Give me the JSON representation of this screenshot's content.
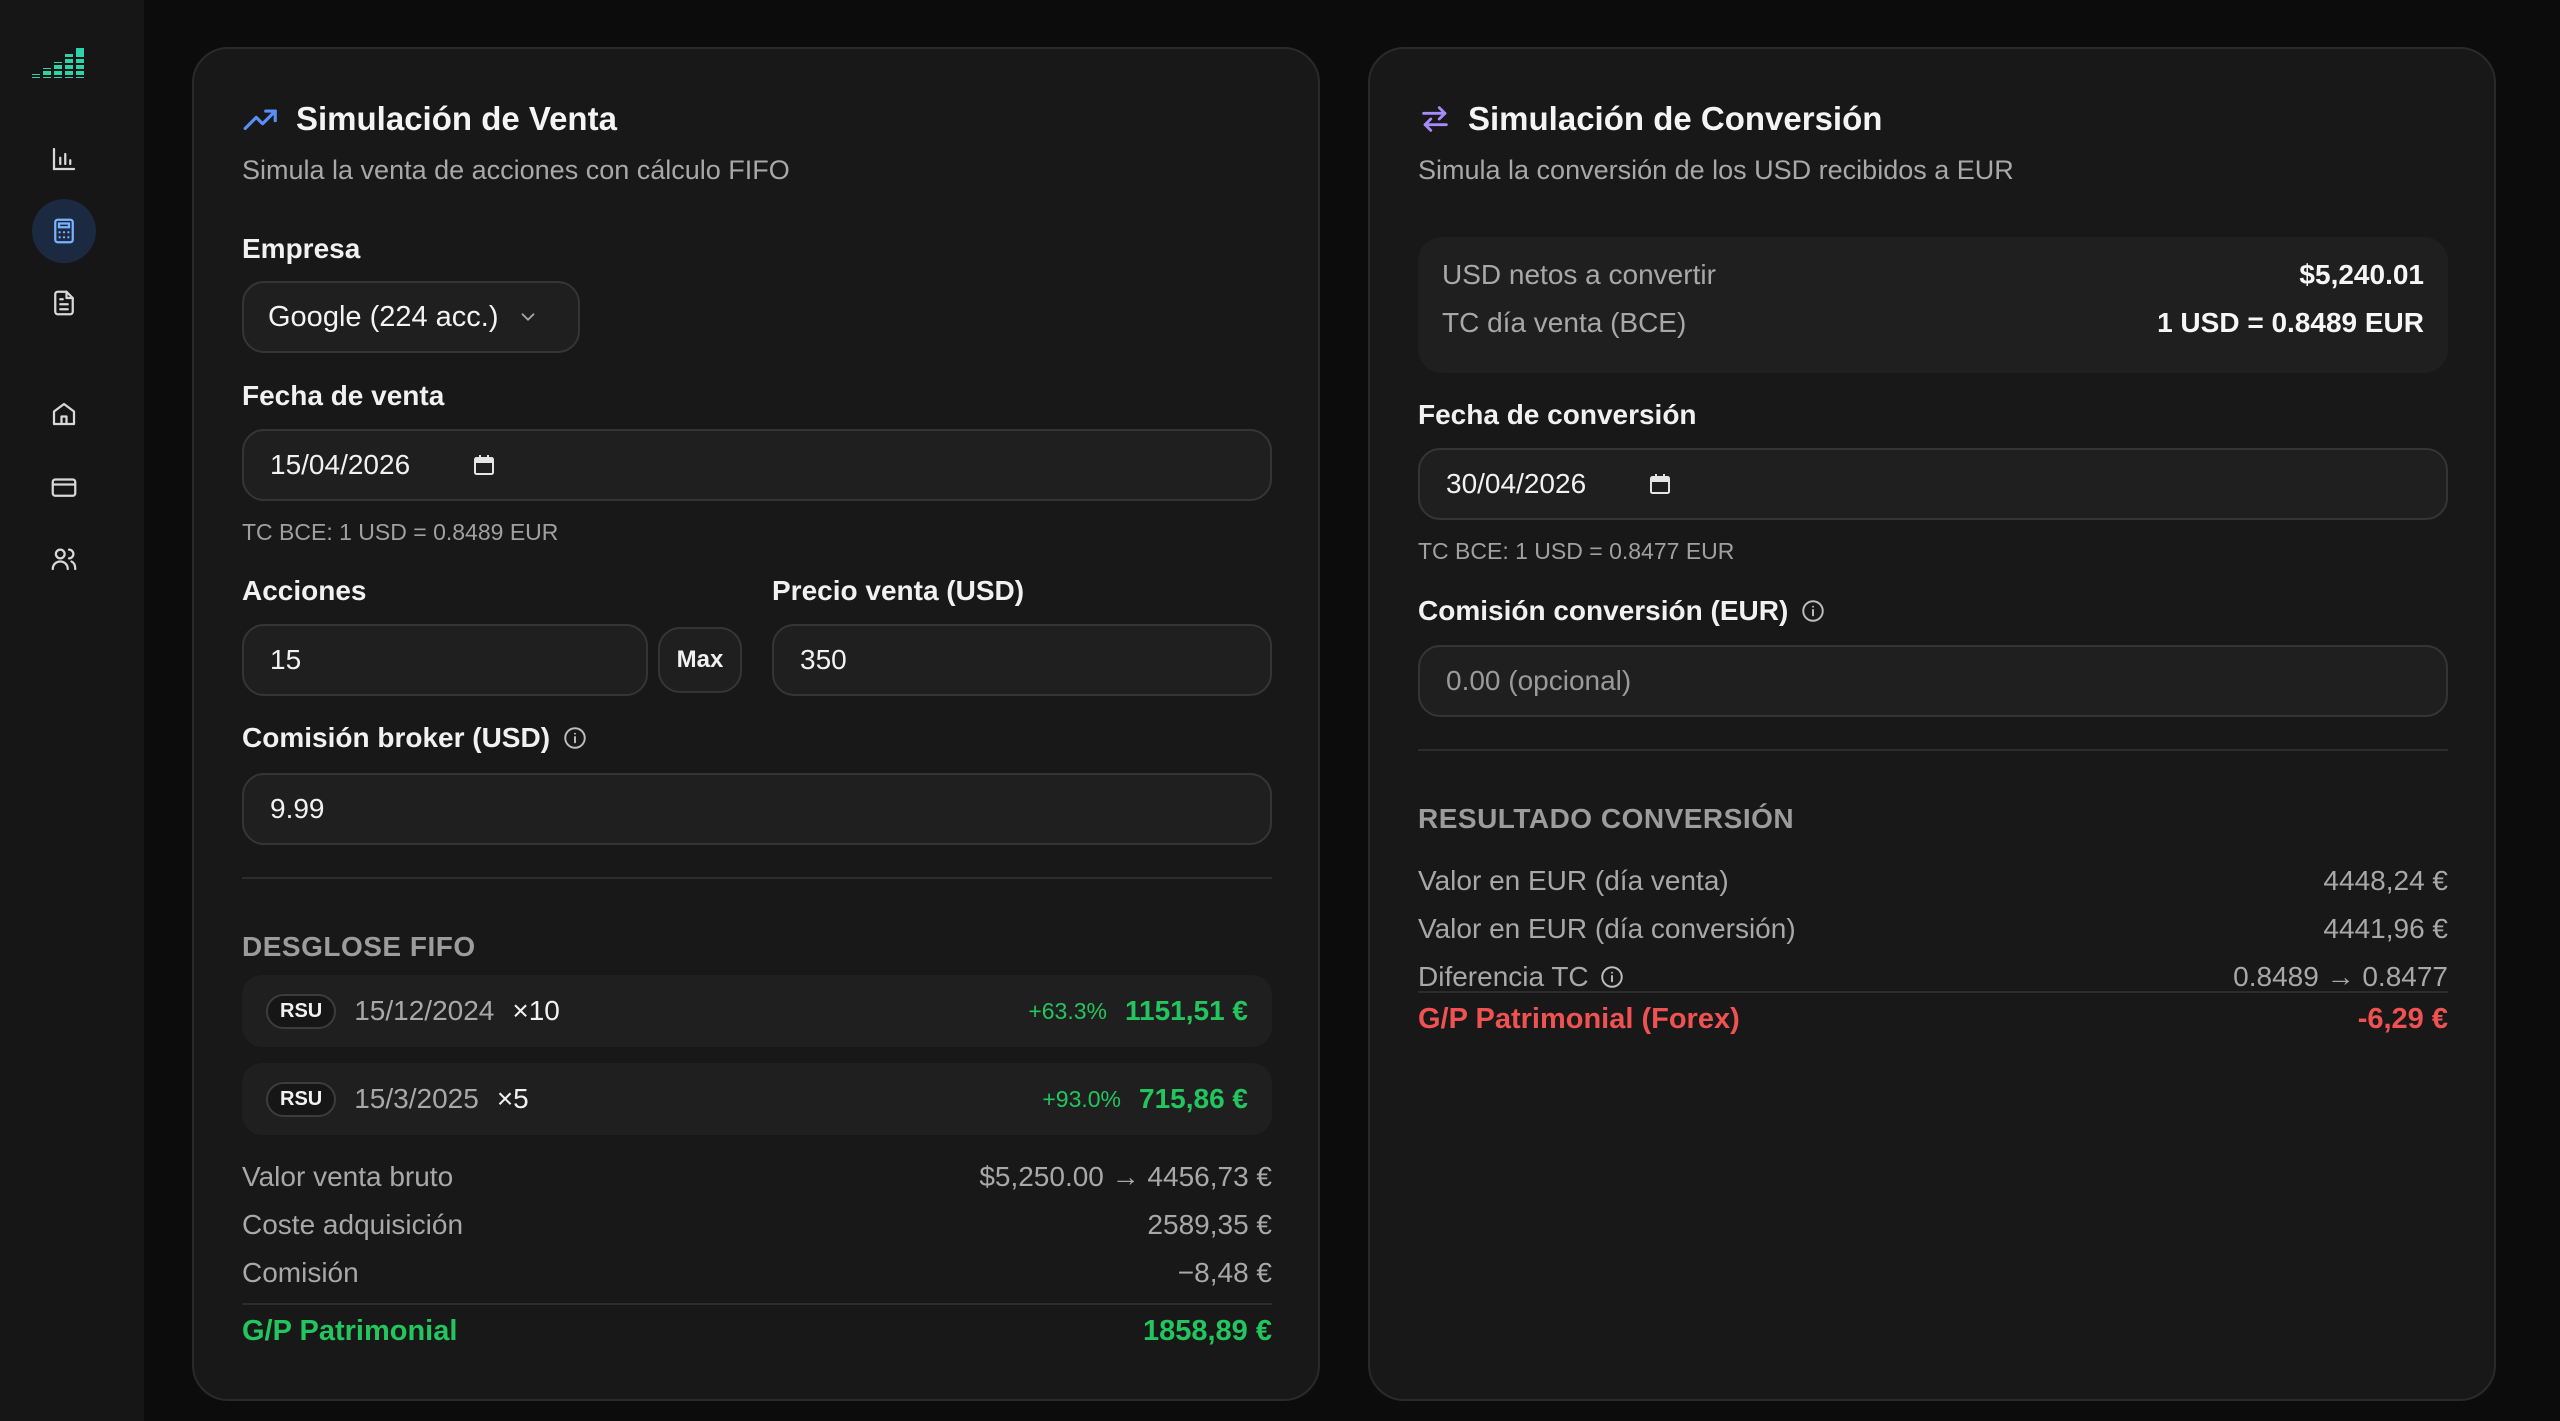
{
  "colors": {
    "accent": "#7ab2ff",
    "positive": "#22c55e",
    "negative": "#f05252",
    "logo": "#2dd4a8"
  },
  "sidebar": {
    "items": [
      {
        "icon": "bar-chart-icon"
      },
      {
        "icon": "calculator-icon",
        "active": true
      },
      {
        "icon": "document-icon"
      },
      {
        "icon": "home-icon"
      },
      {
        "icon": "credit-card-icon"
      },
      {
        "icon": "users-icon"
      }
    ]
  },
  "sale": {
    "title": "Simulación de Venta",
    "subtitle": "Simula la venta de acciones con cálculo FIFO",
    "company_label": "Empresa",
    "company_value": "Google (224 acc.)",
    "date_label": "Fecha de venta",
    "date_value": "15/04/2026",
    "date_hint": "TC BCE: 1 USD = 0.8489 EUR",
    "shares_label": "Acciones",
    "shares_value": "15",
    "max_label": "Max",
    "price_label": "Precio venta (USD)",
    "price_value": "350",
    "fee_label": "Comisión broker (USD)",
    "fee_value": "9.99",
    "fifo_header": "DESGLOSE FIFO",
    "lots": [
      {
        "type": "RSU",
        "date": "15/12/2024",
        "qty": "×10",
        "pct": "+63.3%",
        "value": "1151,51 €"
      },
      {
        "type": "RSU",
        "date": "15/3/2025",
        "qty": "×5",
        "pct": "+93.0%",
        "value": "715,86 €"
      }
    ],
    "gross_label": "Valor venta bruto",
    "gross_value": "$5,250.00 → 4456,73 €",
    "cost_label": "Coste adquisición",
    "cost_value": "2589,35 €",
    "commission_label": "Comisión",
    "commission_value": "−8,48 €",
    "gain_label": "G/P Patrimonial",
    "gain_value": "1858,89 €"
  },
  "conversion": {
    "title": "Simulación de Conversión",
    "subtitle": "Simula la conversión de los USD recibidos a EUR",
    "net_usd_label": "USD netos a convertir",
    "net_usd_value": "$5,240.01",
    "rate_label": "TC día venta (BCE)",
    "rate_value": "1 USD = 0.8489 EUR",
    "date_label": "Fecha de conversión",
    "date_value": "30/04/2026",
    "date_hint": "TC BCE: 1 USD = 0.8477 EUR",
    "fee_label": "Comisión conversión (EUR)",
    "fee_placeholder": "0.00 (opcional)",
    "result_header": "RESULTADO CONVERSIÓN",
    "eur_sale_label": "Valor en EUR (día venta)",
    "eur_sale_value": "4448,24 €",
    "eur_conv_label": "Valor en EUR (día conversión)",
    "eur_conv_value": "4441,96 €",
    "diff_label": "Diferencia TC",
    "diff_value": "0.8489 → 0.8477",
    "gain_label": "G/P Patrimonial (Forex)",
    "gain_value": "-6,29 €"
  }
}
